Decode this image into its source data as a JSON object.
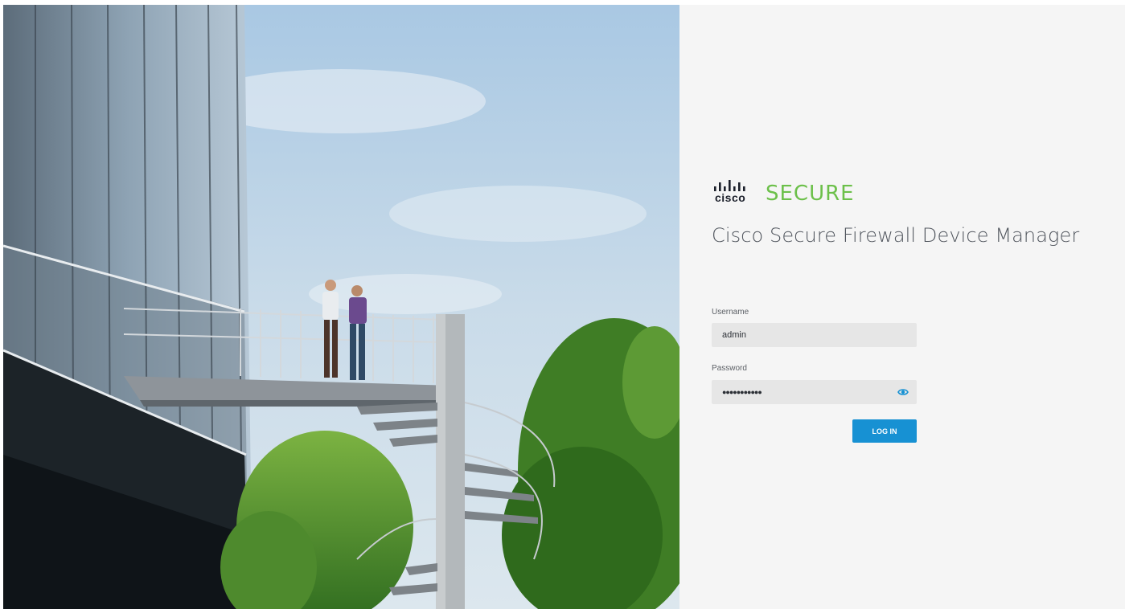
{
  "hero": {
    "image": "office-building-spiral-staircase-photo"
  },
  "brand": {
    "logo_icon": "cisco-bridge-bars-logo",
    "logo_text": "cisco",
    "product_word": "SECURE",
    "product_color": "#6cc04a"
  },
  "app": {
    "title": "Cisco Secure Firewall Device Manager"
  },
  "login_form": {
    "username_label": "Username",
    "username_value": "admin",
    "password_label": "Password",
    "password_value": "●●●●●●●●●●●",
    "show_password_icon": "eye-icon",
    "login_button_label": "LOG IN",
    "accent_color": "#1791d3"
  }
}
